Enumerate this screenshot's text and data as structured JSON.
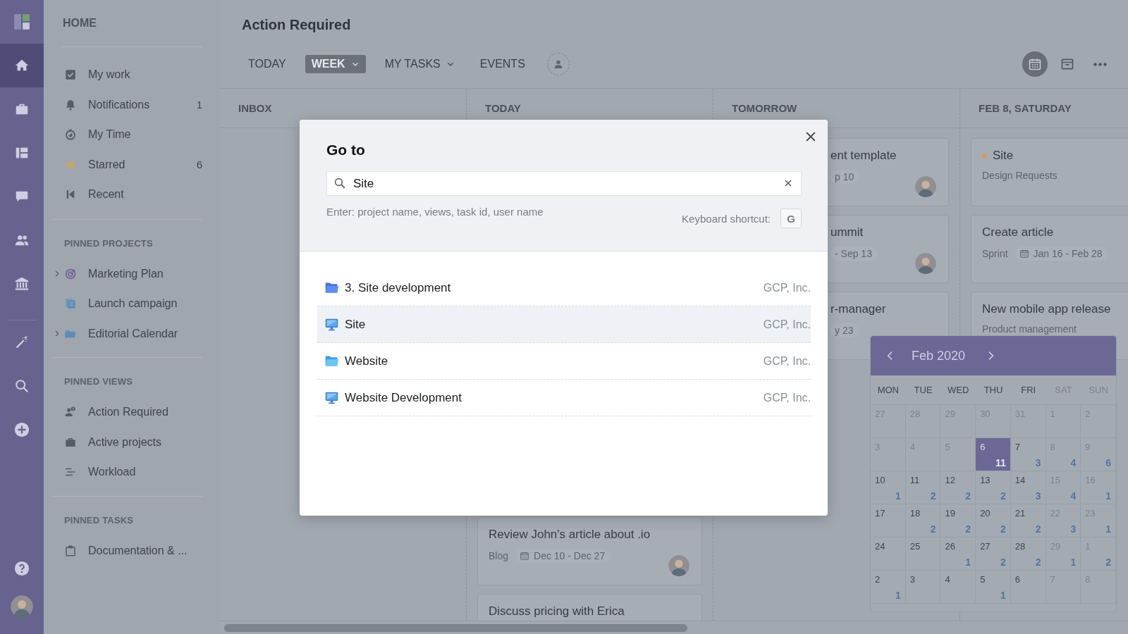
{
  "rail": {
    "items": [
      {
        "kind": "home",
        "selected": true
      },
      {
        "kind": "briefcase",
        "selected": false
      },
      {
        "kind": "board",
        "selected": false
      },
      {
        "kind": "chat",
        "selected": false
      },
      {
        "kind": "people",
        "selected": false
      },
      {
        "kind": "bank",
        "selected": false
      }
    ],
    "tools": [
      {
        "kind": "wand"
      },
      {
        "kind": "search"
      },
      {
        "kind": "add"
      }
    ],
    "footer": [
      {
        "kind": "help"
      },
      {
        "kind": "avatar"
      }
    ]
  },
  "sidebar": {
    "title": "HOME",
    "items": [
      {
        "kind": "check",
        "label": "My work"
      },
      {
        "kind": "bell",
        "label": "Notifications",
        "count": "1"
      },
      {
        "kind": "timer",
        "label": "My Time"
      },
      {
        "kind": "star",
        "label": "Starred",
        "count": "6"
      },
      {
        "kind": "recent",
        "label": "Recent"
      }
    ],
    "sections": [
      {
        "title": "PINNED PROJECTS",
        "items": [
          {
            "kind": "target",
            "label": "Marketing Plan",
            "expandable": true
          },
          {
            "kind": "doc",
            "label": "Launch campaign",
            "expandable": false
          },
          {
            "kind": "folder",
            "label": "Editorial Calendar",
            "expandable": true
          }
        ]
      },
      {
        "title": "PINNED VIEWS",
        "items": [
          {
            "kind": "user-alert",
            "label": "Action Required"
          },
          {
            "kind": "briefcase",
            "label": "Active projects"
          },
          {
            "kind": "lines",
            "label": "Workload"
          }
        ]
      },
      {
        "title": "PINNED TASKS",
        "items": [
          {
            "kind": "clipboard",
            "label": "Documentation & ..."
          }
        ]
      }
    ]
  },
  "page": {
    "title": "Action Required",
    "tabs": [
      {
        "label": "TODAY",
        "selected": false,
        "dropdown": false
      },
      {
        "label": "WEEK",
        "selected": true,
        "dropdown": true
      },
      {
        "label": "MY TASKS",
        "selected": false,
        "dropdown": true
      },
      {
        "label": "EVENTS",
        "selected": false,
        "dropdown": false
      }
    ],
    "toolbar": [
      {
        "kind": "calendar",
        "selected": true
      },
      {
        "kind": "archive",
        "selected": false
      },
      {
        "kind": "more",
        "selected": false
      }
    ]
  },
  "board": {
    "columns": [
      {
        "title": "INBOX"
      },
      {
        "title": "TODAY",
        "cards": [
          {
            "title": "Review John's article about .io",
            "tag": "Blog",
            "dates": "Dec 10 - Dec 27",
            "avatar": true
          },
          {
            "title": "Discuss pricing with Erica"
          }
        ]
      },
      {
        "title": "TOMORROW",
        "cards": [
          {
            "title": "ent template",
            "dates": "p 10",
            "avatar": true
          },
          {
            "title": "ummit",
            "dates": "- Sep 13",
            "avatar": true
          },
          {
            "title": "r-manager",
            "dates": "y 23"
          }
        ]
      },
      {
        "title": "FEB 8, SATURDAY",
        "cards": [
          {
            "title": "Site",
            "color": "#d39a5c",
            "tag": "Design Requests"
          },
          {
            "title": "Create article",
            "tag": "Sprint",
            "dates": "Jan 16 - Feb 28"
          },
          {
            "title": "New mobile app release",
            "tag": "Product management"
          }
        ]
      }
    ]
  },
  "calendar": {
    "month": "Feb 2020",
    "weekdays": [
      {
        "label": "MON",
        "weekend": false
      },
      {
        "label": "TUE",
        "weekend": false
      },
      {
        "label": "WED",
        "weekend": false
      },
      {
        "label": "THU",
        "weekend": false
      },
      {
        "label": "FRI",
        "weekend": false
      },
      {
        "label": "SAT",
        "weekend": true
      },
      {
        "label": "SUN",
        "weekend": true
      }
    ],
    "weeks": [
      [
        {
          "day": "27",
          "muted": true,
          "selected": false
        },
        {
          "day": "28",
          "muted": true,
          "selected": false
        },
        {
          "day": "29",
          "muted": true,
          "selected": false
        },
        {
          "day": "30",
          "muted": true,
          "selected": false
        },
        {
          "day": "31",
          "muted": true,
          "selected": false
        },
        {
          "day": "1",
          "muted": true,
          "selected": false
        },
        {
          "day": "2",
          "muted": true,
          "selected": false
        }
      ],
      [
        {
          "day": "3",
          "muted": true,
          "selected": false
        },
        {
          "day": "4",
          "muted": true,
          "selected": false
        },
        {
          "day": "5",
          "muted": true,
          "selected": false
        },
        {
          "day": "6",
          "count": "11",
          "muted": false,
          "selected": true
        },
        {
          "day": "7",
          "count": "3",
          "muted": false,
          "selected": false
        },
        {
          "day": "8",
          "count": "4",
          "muted": true,
          "selected": false
        },
        {
          "day": "9",
          "count": "6",
          "muted": true,
          "selected": false
        }
      ],
      [
        {
          "day": "10",
          "count": "1",
          "muted": false,
          "selected": false
        },
        {
          "day": "11",
          "count": "2",
          "muted": false,
          "selected": false
        },
        {
          "day": "12",
          "count": "2",
          "muted": false,
          "selected": false
        },
        {
          "day": "13",
          "count": "2",
          "muted": false,
          "selected": false
        },
        {
          "day": "14",
          "count": "3",
          "muted": false,
          "selected": false
        },
        {
          "day": "15",
          "count": "4",
          "muted": true,
          "selected": false
        },
        {
          "day": "16",
          "count": "1",
          "muted": true,
          "selected": false
        }
      ],
      [
        {
          "day": "17",
          "muted": false,
          "selected": false
        },
        {
          "day": "18",
          "count": "2",
          "muted": false,
          "selected": false
        },
        {
          "day": "19",
          "count": "2",
          "muted": false,
          "selected": false
        },
        {
          "day": "20",
          "count": "2",
          "muted": false,
          "selected": false
        },
        {
          "day": "21",
          "count": "2",
          "muted": false,
          "selected": false
        },
        {
          "day": "22",
          "count": "3",
          "muted": true,
          "selected": false
        },
        {
          "day": "23",
          "count": "1",
          "muted": true,
          "selected": false
        }
      ],
      [
        {
          "day": "24",
          "muted": false,
          "selected": false
        },
        {
          "day": "25",
          "muted": false,
          "selected": false
        },
        {
          "day": "26",
          "count": "1",
          "muted": false,
          "selected": false
        },
        {
          "day": "27",
          "count": "2",
          "muted": false,
          "selected": false
        },
        {
          "day": "28",
          "count": "2",
          "muted": false,
          "selected": false
        },
        {
          "day": "29",
          "count": "1",
          "muted": true,
          "selected": false
        },
        {
          "day": "1",
          "count": "2",
          "muted": true,
          "selected": false
        }
      ],
      [
        {
          "day": "2",
          "count": "1",
          "muted": false,
          "selected": false
        },
        {
          "day": "3",
          "muted": false,
          "selected": false
        },
        {
          "day": "4",
          "muted": false,
          "selected": false
        },
        {
          "day": "5",
          "count": "1",
          "muted": false,
          "selected": false
        },
        {
          "day": "6",
          "muted": false,
          "selected": false
        },
        {
          "day": "7",
          "muted": true,
          "selected": false
        },
        {
          "day": "8",
          "muted": true,
          "selected": false
        }
      ]
    ]
  },
  "dialog": {
    "title": "Go to",
    "search": {
      "value": "Site"
    },
    "hint": "Enter: project name, views, task id, user name",
    "shortcut_label": "Keyboard shortcut:",
    "shortcut_key": "G",
    "results": [
      {
        "kind": "project",
        "name": "3. Site development",
        "org": "GCP, Inc.",
        "selected": false
      },
      {
        "kind": "view",
        "name": "Site",
        "org": "GCP, Inc.",
        "selected": true
      },
      {
        "kind": "folder",
        "name": "Website",
        "org": "GCP, Inc.",
        "selected": false
      },
      {
        "kind": "view",
        "name": "Website Development",
        "org": "GCP, Inc.",
        "selected": false
      }
    ]
  }
}
